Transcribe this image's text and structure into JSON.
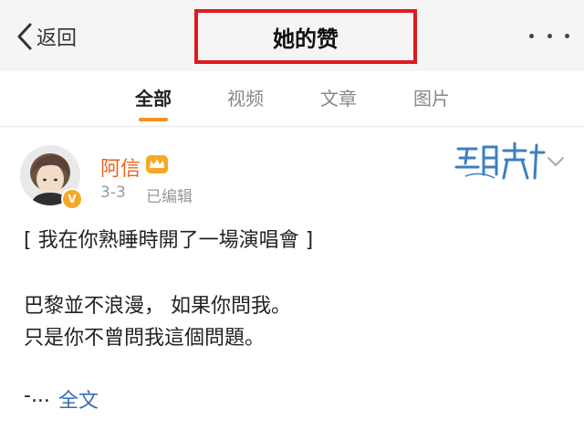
{
  "nav": {
    "back_label": "返回",
    "title": "她的赞",
    "highlight_color": "#e0191e"
  },
  "tabs": [
    {
      "label": "全部",
      "active": true
    },
    {
      "label": "视频",
      "active": false
    },
    {
      "label": "文章",
      "active": false
    },
    {
      "label": "图片",
      "active": false
    }
  ],
  "post": {
    "username": "阿信",
    "date": "3-3",
    "edited_label": "已编辑",
    "verified_badge": "V",
    "lines": [
      "[ 我在你熟睡時開了一場演唱會 ]",
      "巴黎並不浪漫， 如果你問我。",
      "只是你不曾問我這個問題。"
    ],
    "ellipsis": "-...",
    "full_text_label": "全文",
    "name_color": "#e8651a",
    "link_color": "#3b6db3",
    "icons": [
      "crown-icon",
      "chevron-down-icon",
      "watermark-logo"
    ]
  }
}
